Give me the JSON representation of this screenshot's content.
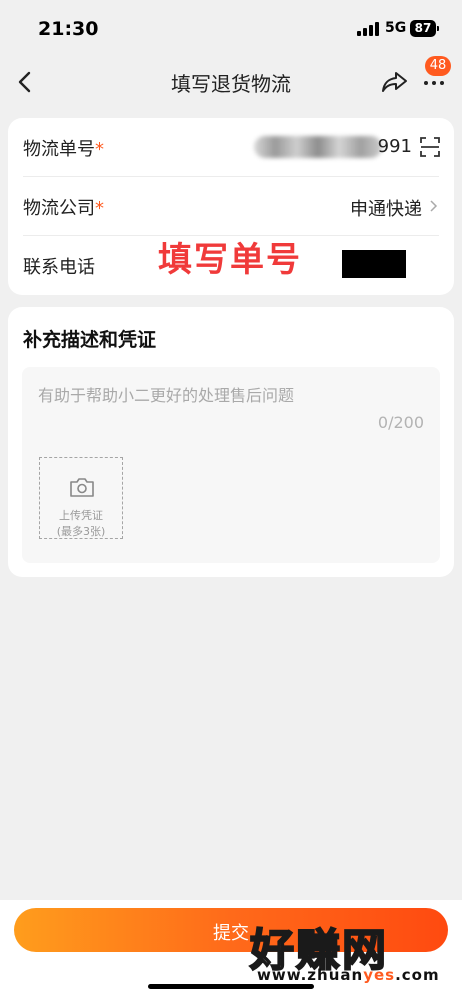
{
  "status_bar": {
    "time": "21:30",
    "network": "5G",
    "battery": "87"
  },
  "nav": {
    "title": "填写退货物流",
    "badge": "48"
  },
  "form": {
    "tracking_label": "物流单号",
    "tracking_required": "*",
    "tracking_value_suffix": "991",
    "company_label": "物流公司",
    "company_required": "*",
    "company_value": "申通快递",
    "phone_label": "联系电话",
    "overlay_text": "填写单号"
  },
  "supplement": {
    "heading": "补充描述和凭证",
    "placeholder": "有助于帮助小二更好的处理售后问题",
    "counter": "0/200",
    "upload_line1": "上传凭证",
    "upload_line2": "(最多3张)"
  },
  "footer": {
    "submit_label": "提交",
    "watermark": "好赚网",
    "watermark_url_a": "www.zhuan",
    "watermark_url_b": "yes",
    "watermark_url_c": ".com"
  },
  "colors": {
    "accent": "#ff5a1f",
    "button_start": "#ff9d1c",
    "button_end": "#ff4a10",
    "overlay_red": "#f03a3a"
  }
}
